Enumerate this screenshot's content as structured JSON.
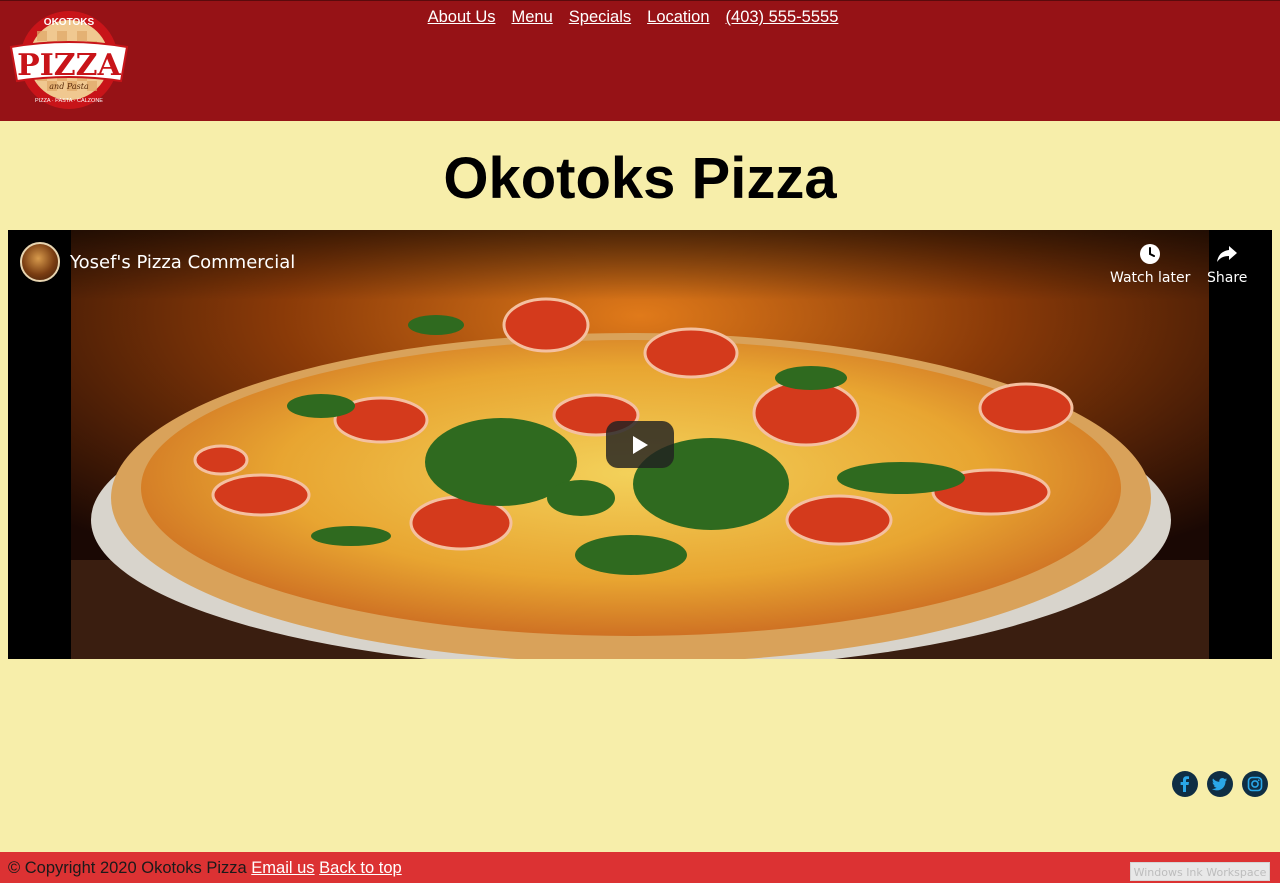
{
  "logo": {
    "top_text": "OKOTOKS",
    "main_text": "PIZZA",
    "sub_text": "and Pasta",
    "bottom_text": "PIZZA · PASTA · CALZONE"
  },
  "nav": {
    "items": [
      "About Us",
      "Menu",
      "Specials",
      "Location",
      "(403) 555-5555"
    ]
  },
  "page_title": "Okotoks Pizza",
  "video": {
    "title": "Yosef's Pizza Commercial",
    "watch_later": "Watch later",
    "share": "Share"
  },
  "social": {
    "icons": [
      "facebook-icon",
      "twitter-icon",
      "instagram-icon"
    ]
  },
  "footer": {
    "copyright": "© Copyright 2020 Okotoks Pizza",
    "email_link": "Email us",
    "top_link": "Back to top"
  },
  "taskbar": {
    "ink_workspace": "Windows Ink Workspace"
  },
  "colors": {
    "header_bg": "#961216",
    "page_bg": "#f7eeaa",
    "footer_bg": "#dc3233",
    "social_bg": "#0f2e44"
  }
}
